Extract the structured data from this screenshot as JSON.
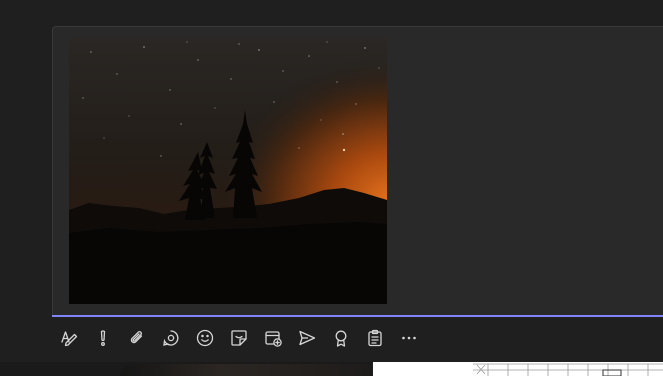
{
  "compose": {
    "attachment": {
      "kind": "image",
      "subject": "night-sky-tree-silhouette"
    },
    "toolbar": [
      {
        "name": "format-icon"
      },
      {
        "name": "important-icon"
      },
      {
        "name": "attach-icon"
      },
      {
        "name": "loop-icon"
      },
      {
        "name": "emoji-icon"
      },
      {
        "name": "sticker-icon"
      },
      {
        "name": "schedule-meeting-icon"
      },
      {
        "name": "stream-icon"
      },
      {
        "name": "praise-icon"
      },
      {
        "name": "forms-icon"
      },
      {
        "name": "more-options-icon"
      }
    ]
  },
  "colors": {
    "background": "#1f1f1f",
    "compose_surface": "#292929",
    "focus_accent": "#7f85f5",
    "icon": "#d6d6d6"
  }
}
